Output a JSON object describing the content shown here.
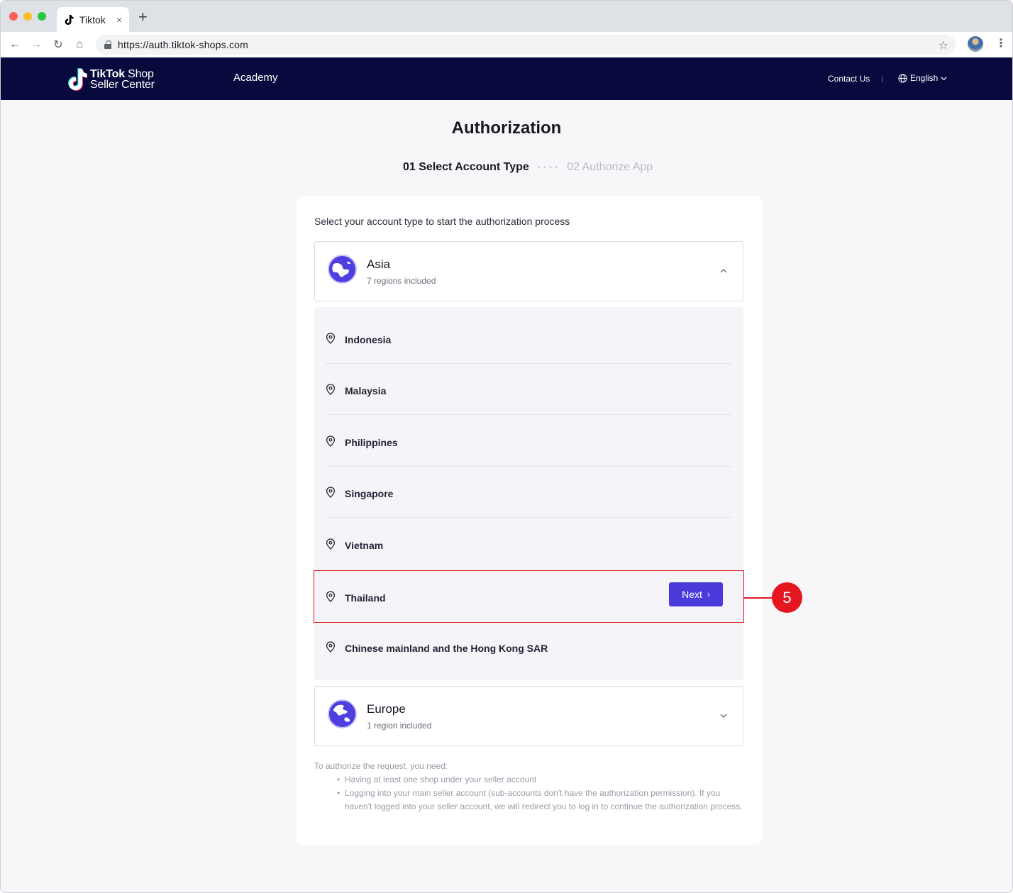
{
  "browser": {
    "tab_title": "Tiktok",
    "tab_close": "×",
    "new_tab": "+",
    "url": "https://auth.tiktok-shops.com",
    "back": "←",
    "forward": "→",
    "reload": "↻",
    "home": "⌂",
    "star": "☆",
    "menu": "⋮"
  },
  "header": {
    "logo_line1_bold": "TikTok",
    "logo_line1_light": " Shop",
    "logo_line2": "Seller Center",
    "academy": "Academy",
    "contact": "Contact Us",
    "language": "English"
  },
  "page": {
    "title": "Authorization",
    "step1": "01 Select Account Type",
    "step_dots": "• • • •",
    "step2": "02 Authorize App",
    "intro": "Select your account type to start the authorization process"
  },
  "regions": [
    {
      "name": "Asia",
      "sub": "7 regions included",
      "expanded": true
    },
    {
      "name": "Europe",
      "sub": "1 region included",
      "expanded": false
    }
  ],
  "countries": [
    {
      "name": "Indonesia"
    },
    {
      "name": "Malaysia"
    },
    {
      "name": "Philippines"
    },
    {
      "name": "Singapore"
    },
    {
      "name": "Vietnam"
    },
    {
      "name": "Thailand",
      "selected": true
    },
    {
      "name": "Chinese mainland and the Hong Kong SAR"
    }
  ],
  "next_button": {
    "label": "Next",
    "arrow": "›"
  },
  "note": {
    "heading": "To authorize the request, you need:",
    "items": [
      "Having at least one shop under your seller account",
      "Logging into your main seller account (sub-accounts don't have the authorization permission). If you haven't logged into your seller account, we will redirect you to log in to continue the authorization process."
    ]
  },
  "callout": {
    "number": "5"
  },
  "colors": {
    "header_bg": "#080a3e",
    "accent": "#4b3bdb",
    "highlight": "#e4161f"
  }
}
